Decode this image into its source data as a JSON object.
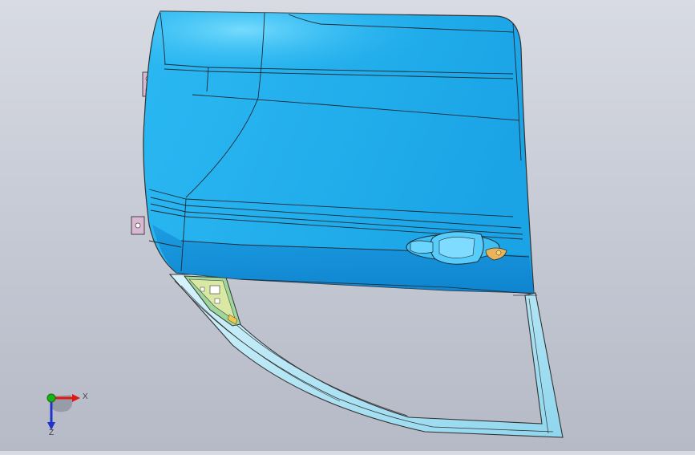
{
  "viewport": {
    "background_top": "#d8dbe3",
    "background_bottom": "#b6bac6",
    "model_color": "#1fa9e8",
    "model_highlight": "#6fd6ff",
    "model_shadow": "#0b78c2",
    "frame_color": "#bfe9f7"
  },
  "triad": {
    "x_label": "X",
    "z_label": "Z",
    "x_color": "#e01818",
    "y_color": "#17b317",
    "z_color": "#2233cc"
  }
}
